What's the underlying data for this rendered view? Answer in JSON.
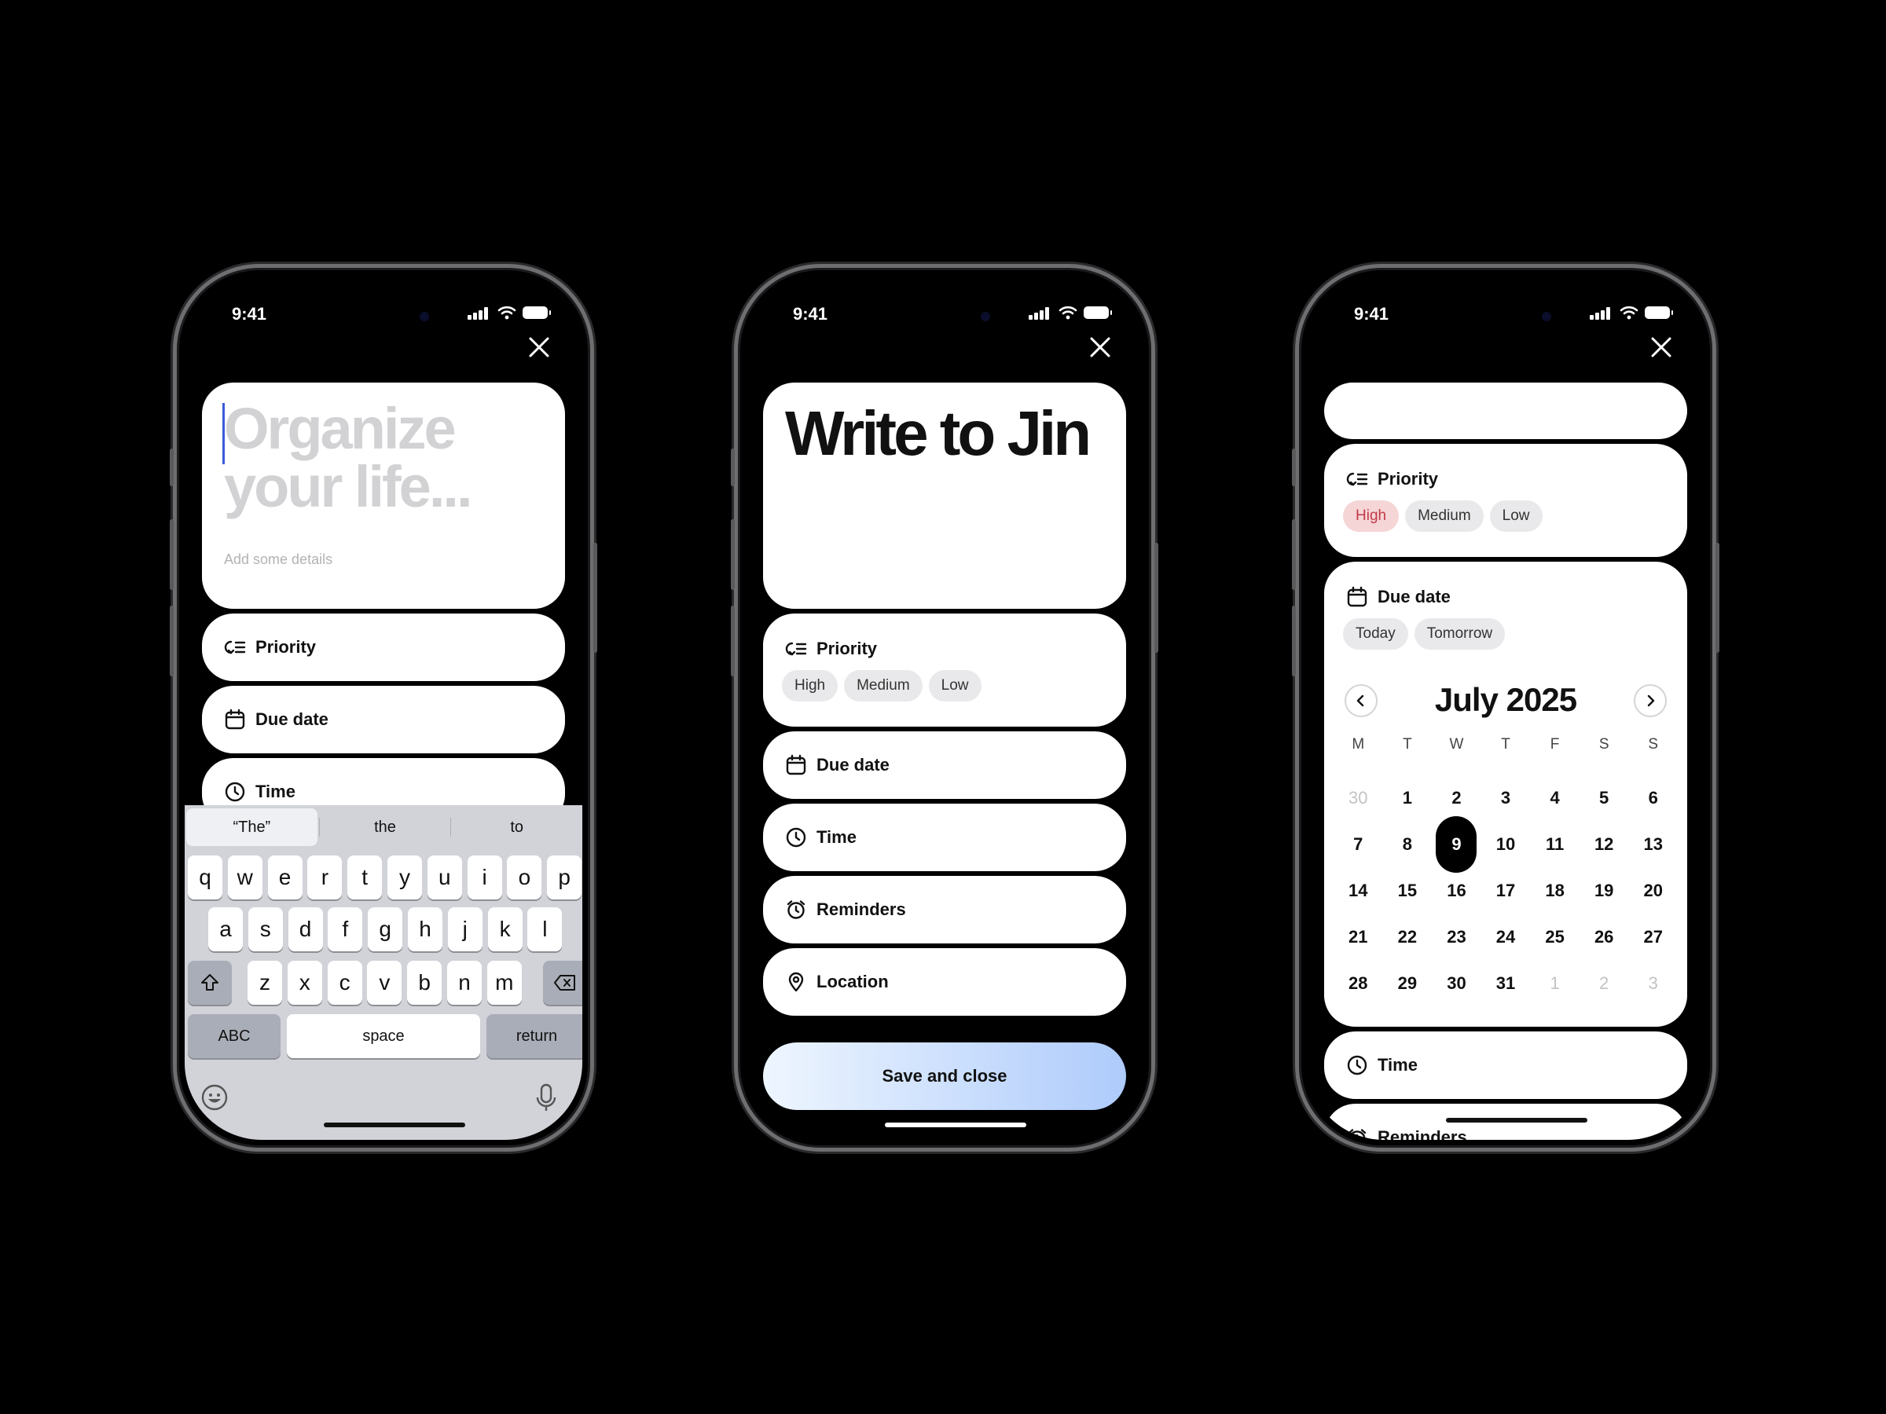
{
  "status": {
    "time": "9:41"
  },
  "phone1": {
    "title_placeholder_line1": "Organize",
    "title_placeholder_line2": "your life...",
    "details_placeholder": "Add some details",
    "rows": {
      "priority": "Priority",
      "due_date": "Due date",
      "time": "Time"
    },
    "keyboard": {
      "suggestions": [
        "“The”",
        "the",
        "to"
      ],
      "row1": [
        "q",
        "w",
        "e",
        "r",
        "t",
        "y",
        "u",
        "i",
        "o",
        "p"
      ],
      "row2": [
        "a",
        "s",
        "d",
        "f",
        "g",
        "h",
        "j",
        "k",
        "l"
      ],
      "row3": [
        "z",
        "x",
        "c",
        "v",
        "b",
        "n",
        "m"
      ],
      "abc": "ABC",
      "space": "space",
      "return": "return"
    }
  },
  "phone2": {
    "title": "Write to Jin",
    "priority_label": "Priority",
    "priority_options": [
      "High",
      "Medium",
      "Low"
    ],
    "rows": {
      "due_date": "Due date",
      "time": "Time",
      "reminders": "Reminders",
      "location": "Location"
    },
    "save_label": "Save and close"
  },
  "phone3": {
    "priority_label": "Priority",
    "priority_options": [
      "High",
      "Medium",
      "Low"
    ],
    "priority_selected": "High",
    "due_label": "Due date",
    "due_options": [
      "Today",
      "Tomorrow"
    ],
    "calendar": {
      "month_title": "July 2025",
      "weekdays": [
        "M",
        "T",
        "W",
        "T",
        "F",
        "S",
        "S"
      ],
      "weeks": [
        [
          "30",
          "1",
          "2",
          "3",
          "4",
          "5",
          "6"
        ],
        [
          "7",
          "8",
          "9",
          "10",
          "11",
          "12",
          "13"
        ],
        [
          "14",
          "15",
          "16",
          "17",
          "18",
          "19",
          "20"
        ],
        [
          "21",
          "22",
          "23",
          "24",
          "25",
          "26",
          "27"
        ],
        [
          "28",
          "29",
          "30",
          "31",
          "1",
          "2",
          "3"
        ]
      ],
      "selected_day": "9"
    },
    "time_label": "Time",
    "reminders_label": "Reminders"
  },
  "colors": {
    "background": "#000000",
    "card": "#ffffff",
    "chip": "#e9e9eb",
    "chip_high_selected_bg": "#f6d5d7",
    "chip_high_selected_text": "#c13a48",
    "save_gradient_start": "#eef6ff",
    "save_gradient_end": "#aecbfb",
    "cursor": "#3b5bdb"
  }
}
